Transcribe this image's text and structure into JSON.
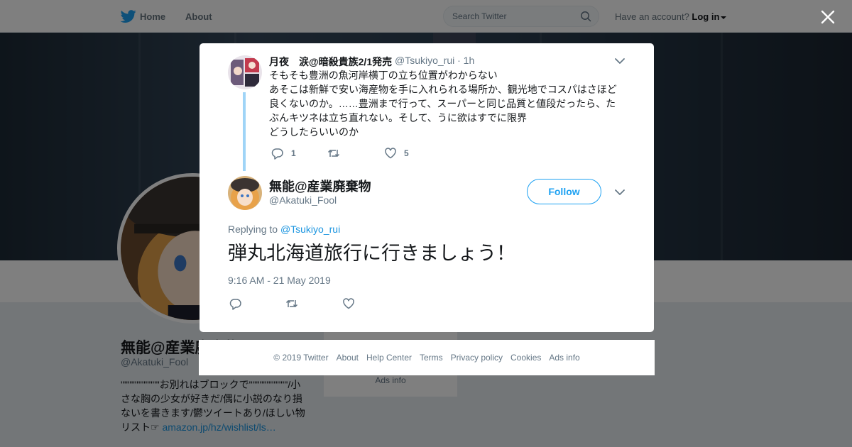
{
  "topbar": {
    "home_label": "Home",
    "about_label": "About",
    "search_placeholder": "Search Twitter",
    "have_account": "Have an account?",
    "login_label": "Log in"
  },
  "profile": {
    "name": "無能@産業廃棄物",
    "handle": "@Akatuki_Fool",
    "bio_text": "\"\"\"\"\"\"\"\"\"\"\"お別れはブロックで\"\"\"\"\"\"\"\"\"\"\"/小さな胸の少女が好きだ/偶に小説のなり損ないを書きます/鬱ツイートあり/ほしい物リスト☞ ",
    "bio_link": "amazon.jp/hz/wishlist/ls…",
    "sidebar_ads": "Ads info"
  },
  "thread": {
    "tweet1": {
      "name": "月夜　涙@暗殺貴族2/1発売",
      "handle": "@Tsukiyo_rui · 1h",
      "text": "そもそも豊洲の魚河岸横丁の立ち位置がわからない\nあそこは新鮮で安い海産物を手に入れられる場所か、観光地でコスパはさほど良くないのか。……豊洲まで行って、スーパーと同じ品質と値段だったら、たぶんキツネは立ち直れない。そして、うに欲はすでに限界\nどうしたらいいのか",
      "reply_count": "1",
      "like_count": "5"
    },
    "tweet2": {
      "name": "無能@産業廃棄物",
      "handle": "@Akatuki_Fool",
      "follow_label": "Follow",
      "replying_prefix": "Replying to",
      "replying_to": "@Tsukiyo_rui",
      "text": "弾丸北海道旅行に行きましょう！",
      "timestamp": "9:16 AM - 21 May 2019"
    }
  },
  "footer": {
    "copyright": "© 2019 Twitter",
    "links": [
      "About",
      "Help Center",
      "Terms",
      "Privacy policy",
      "Cookies",
      "Ads info"
    ]
  },
  "colors": {
    "twitter_blue": "#1da1f2",
    "link_blue": "#1b95e0",
    "thread_line": "#9fd4f7",
    "text_secondary": "#657786"
  }
}
